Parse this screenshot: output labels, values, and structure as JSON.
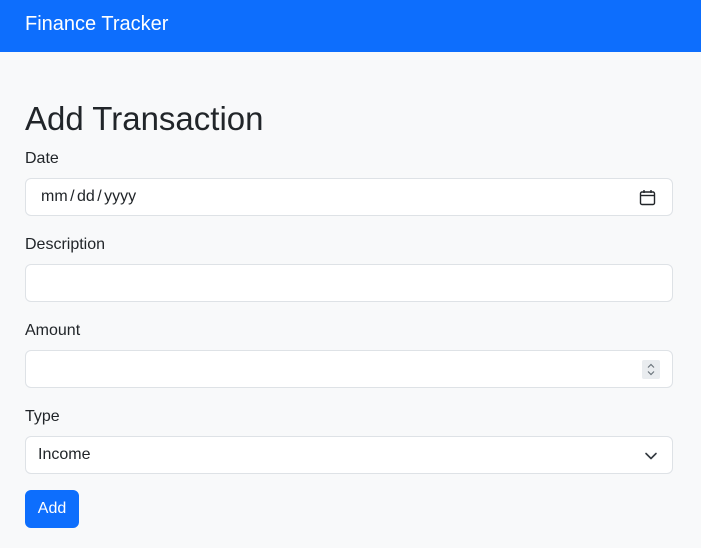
{
  "app": {
    "brand": "Finance Tracker"
  },
  "page": {
    "title": "Add Transaction"
  },
  "form": {
    "date": {
      "label": "Date",
      "placeholder": "mm / dd / yyyy",
      "value": "",
      "icon": "calendar-icon"
    },
    "description": {
      "label": "Description",
      "value": ""
    },
    "amount": {
      "label": "Amount",
      "value": "",
      "icon": "spinner-icon"
    },
    "type": {
      "label": "Type",
      "selected": "Income",
      "icon": "chevron-down-icon"
    },
    "submit_label": "Add"
  },
  "colors": {
    "primary": "#0d6efd",
    "background": "#f8f9fa",
    "border": "#dee2e6",
    "text": "#212529"
  }
}
